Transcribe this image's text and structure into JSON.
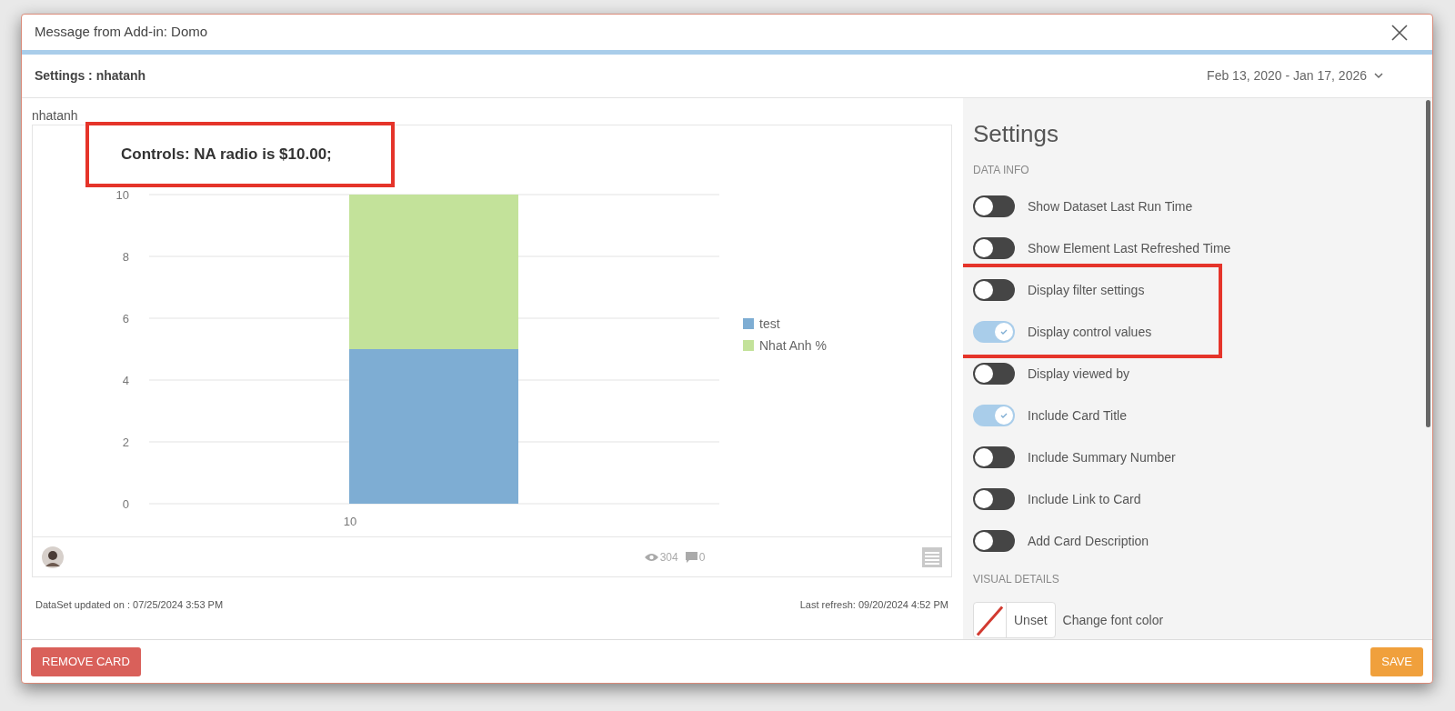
{
  "dialog": {
    "title": "Message from Add-in: Domo"
  },
  "header": {
    "title": "Settings : nhatanh",
    "date_range": "Feb 13, 2020 - Jan 17, 2026"
  },
  "card": {
    "name": "nhatanh",
    "controls_text": "Controls: NA radio is $10.00;",
    "controls_highlighted": true,
    "views": "304",
    "comments": "0",
    "chart_data": {
      "type": "bar",
      "stacked": true,
      "grid": true,
      "legend": true,
      "categories": [
        "10"
      ],
      "ylim": [
        0,
        10
      ],
      "yticks": [
        0,
        2,
        4,
        6,
        8,
        10
      ],
      "series": [
        {
          "name": "test",
          "color": "#7eadd3",
          "values": [
            5
          ]
        },
        {
          "name": "Nhat Anh %",
          "color": "#c3e29a",
          "values": [
            5
          ]
        }
      ]
    }
  },
  "dataset_updated": "DataSet updated on : 07/25/2024 3:53 PM",
  "last_refresh": "Last refresh: 09/20/2024 4:52 PM",
  "settings": {
    "title": "Settings",
    "sections": [
      {
        "heading": "DATA INFO",
        "items": [
          {
            "kind": "toggle",
            "label": "Show Dataset Last Run Time",
            "on": false,
            "highlighted": false
          },
          {
            "kind": "toggle",
            "label": "Show Element Last Refreshed Time",
            "on": false,
            "highlighted": false
          },
          {
            "kind": "toggle",
            "label": "Display filter settings",
            "on": false,
            "highlighted": true
          },
          {
            "kind": "toggle",
            "label": "Display control values",
            "on": true,
            "highlighted": true
          },
          {
            "kind": "toggle",
            "label": "Display viewed by",
            "on": false,
            "highlighted": false
          },
          {
            "kind": "toggle",
            "label": "Include Card Title",
            "on": true,
            "highlighted": false
          },
          {
            "kind": "toggle",
            "label": "Include Summary Number",
            "on": false,
            "highlighted": false
          },
          {
            "kind": "toggle",
            "label": "Include Link to Card",
            "on": false,
            "highlighted": false
          },
          {
            "kind": "toggle",
            "label": "Add Card Description",
            "on": false,
            "highlighted": false
          }
        ]
      },
      {
        "heading": "VISUAL DETAILS",
        "items": [
          {
            "kind": "color",
            "value": "Unset",
            "label": "Change font color"
          }
        ]
      }
    ]
  },
  "buttons": [
    {
      "label": "REMOVE CARD",
      "kind": "danger"
    },
    {
      "label": "SAVE",
      "kind": "primary"
    }
  ]
}
